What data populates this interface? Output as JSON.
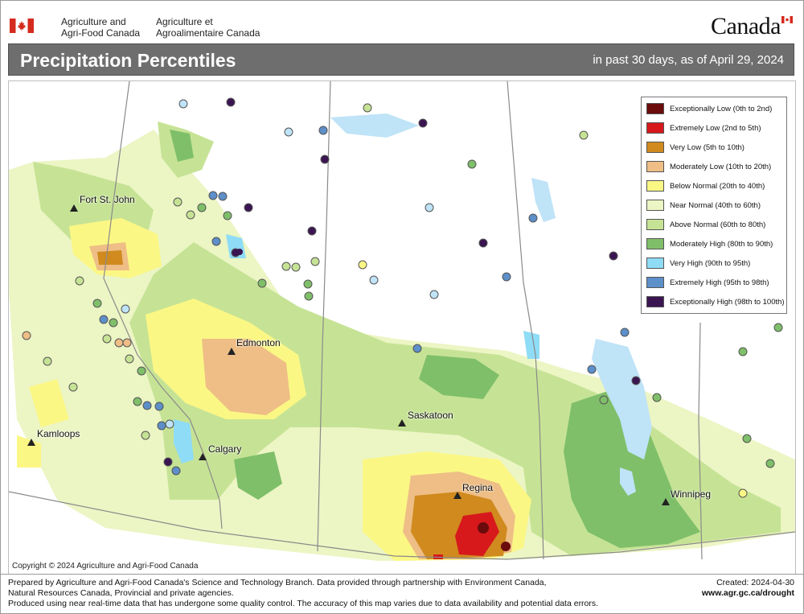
{
  "header": {
    "agency_en_line1": "Agriculture and",
    "agency_en_line2": "Agri-Food Canada",
    "agency_fr_line1": "Agriculture et",
    "agency_fr_line2": "Agroalimentaire Canada",
    "wordmark": "Canada",
    "title": "Precipitation Percentiles",
    "subtitle": "in past 30 days, as of April 29, 2024"
  },
  "legend": {
    "items": [
      {
        "label": "Exceptionally Low (0th to 2nd)",
        "color": "#6b0b0b"
      },
      {
        "label": "Extremely Low (2nd to 5th)",
        "color": "#d7191c"
      },
      {
        "label": "Very Low (5th to 10th)",
        "color": "#d08a1e"
      },
      {
        "label": "Moderately Low (10th to 20th)",
        "color": "#eebe86"
      },
      {
        "label": "Below Normal (20th to 40th)",
        "color": "#fbf785"
      },
      {
        "label": "Near Normal (40th to 60th)",
        "color": "#ecf5c4"
      },
      {
        "label": "Above Normal (60th to 80th)",
        "color": "#c6e395"
      },
      {
        "label": "Moderately High (80th to 90th)",
        "color": "#7fbf6a"
      },
      {
        "label": "Very High (90th to 95th)",
        "color": "#8fdcf6"
      },
      {
        "label": "Extremely High (95th to 98th)",
        "color": "#5d8fc9"
      },
      {
        "label": "Exceptionally High (98th to 100th)",
        "color": "#3b1552"
      }
    ]
  },
  "cities": [
    {
      "name": "Fort St. John"
    },
    {
      "name": "Edmonton"
    },
    {
      "name": "Kamloops"
    },
    {
      "name": "Calgary"
    },
    {
      "name": "Saskatoon"
    },
    {
      "name": "Regina"
    },
    {
      "name": "Winnipeg"
    }
  ],
  "map": {
    "copyright": "Copyright © 2024 Agriculture and Agri-Food Canada",
    "land_color": "#ffffff",
    "water_color": "#bfe3f7",
    "border_color": "#8a8a8a"
  },
  "footer": {
    "line1": "Prepared by Agriculture and Agri-Food Canada's Science and Technology Branch. Data provided through partnership with Environment Canada,",
    "line2": "Natural Resources Canada, Provincial and private agencies.",
    "line3": "Produced using near real-time data that has undergone some quality control. The accuracy of this map varies due to data availability and potential data errors.",
    "created": "Created: 2024-04-30",
    "url": "www.agr.gc.ca/drought"
  }
}
